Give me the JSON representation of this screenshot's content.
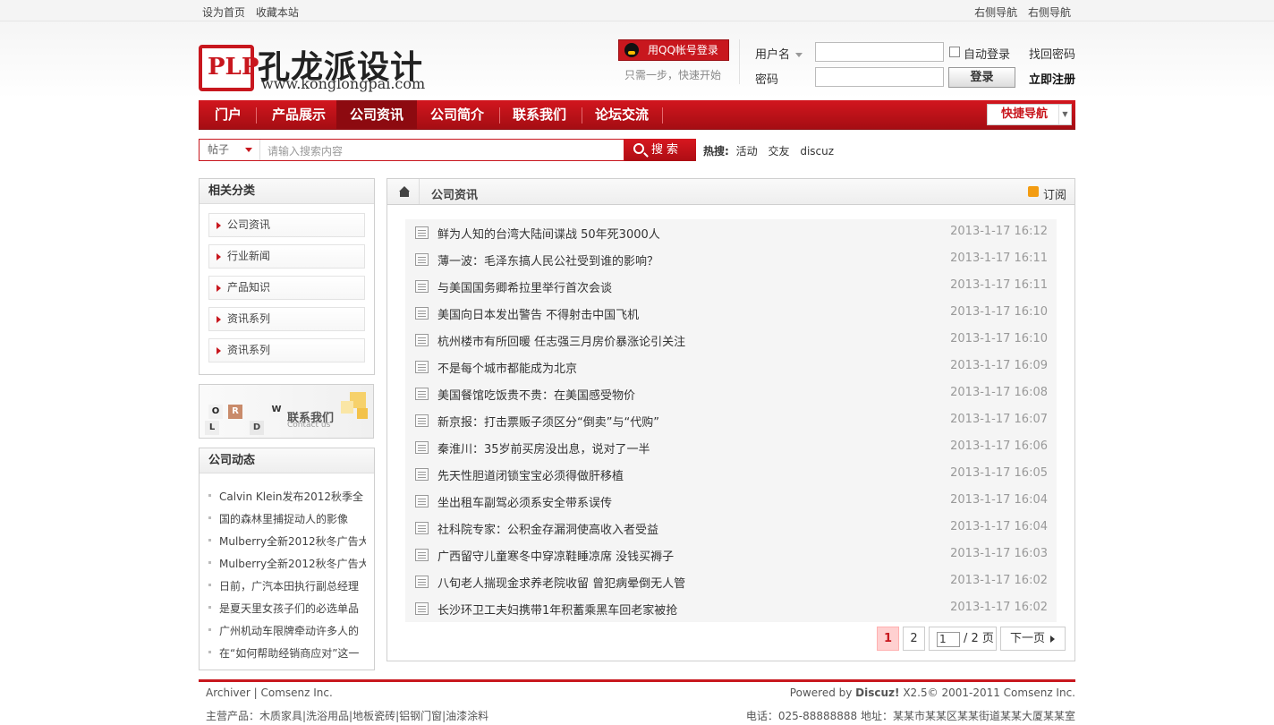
{
  "topbar": {
    "left": [
      "设为首页",
      "收藏本站"
    ],
    "right": [
      "右侧导航",
      "右侧导航"
    ]
  },
  "logo": {
    "mark": "PLP",
    "title": "孔龙派设计",
    "url": "www.konglongpai.com"
  },
  "qq": {
    "button": "用QQ帐号登录",
    "tip": "只需一步，快速开始"
  },
  "login": {
    "username_label": "用户名",
    "password_label": "密码",
    "auto_login": "自动登录",
    "find_password": "找回密码",
    "login_button": "登录",
    "register": "立即注册"
  },
  "nav": {
    "items": [
      "门户",
      "产品展示",
      "公司资讯",
      "公司简介",
      "联系我们",
      "论坛交流"
    ],
    "active": "公司资讯",
    "quick": "快捷导航"
  },
  "search": {
    "type": "帖子",
    "placeholder": "请输入搜索内容",
    "button": "搜索",
    "hot_label": "热搜:",
    "hot": [
      "活动",
      "交友",
      "discuz"
    ]
  },
  "sidebar": {
    "category_title": "相关分类",
    "categories": [
      "公司资讯",
      "行业新闻",
      "产品知识",
      "资讯系列",
      "资讯系列"
    ],
    "contact_banner": {
      "big": "联系我们",
      "small": "Contact us",
      "letters": [
        "W",
        "O",
        "R",
        "L",
        "D"
      ]
    },
    "news_title": "公司动态",
    "news": [
      "Calvin Klein发布2012秋季全",
      "国的森林里捕捉动人的影像",
      "Mulberry全新2012秋冬广告大",
      "Mulberry全新2012秋冬广告大",
      "日前，广汽本田执行副总经理",
      "是夏天里女孩子们的必选单品",
      "广州机动车限牌牵动许多人的",
      "在“如何帮助经销商应对”这一"
    ]
  },
  "main": {
    "breadcrumb": "公司资讯",
    "subscribe": "订阅",
    "articles": [
      {
        "title": "鲜为人知的台湾大陆间谍战 50年死3000人",
        "date": "2013-1-17 16:12"
      },
      {
        "title": "薄一波：毛泽东搞人民公社受到谁的影响？",
        "date": "2013-1-17 16:11"
      },
      {
        "title": "与美国国务卿希拉里举行首次会谈",
        "date": "2013-1-17 16:11"
      },
      {
        "title": "美国向日本发出警告 不得射击中国飞机",
        "date": "2013-1-17 16:10"
      },
      {
        "title": "杭州楼市有所回暖 任志强三月房价暴涨论引关注",
        "date": "2013-1-17 16:10"
      },
      {
        "title": "不是每个城市都能成为北京",
        "date": "2013-1-17 16:09"
      },
      {
        "title": "美国餐馆吃饭贵不贵：在美国感受物价",
        "date": "2013-1-17 16:08"
      },
      {
        "title": "新京报：打击票贩子须区分“倒卖”与“代购”",
        "date": "2013-1-17 16:07"
      },
      {
        "title": "秦淮川：35岁前买房没出息，说对了一半",
        "date": "2013-1-17 16:06"
      },
      {
        "title": "先天性胆道闭锁宝宝必须得做肝移植",
        "date": "2013-1-17 16:05"
      },
      {
        "title": "坐出租车副驾必须系安全带系误传",
        "date": "2013-1-17 16:04"
      },
      {
        "title": "社科院专家：公积金存漏洞使高收入者受益",
        "date": "2013-1-17 16:04"
      },
      {
        "title": "广西留守儿童寒冬中穿凉鞋睡凉席 没钱买褥子",
        "date": "2013-1-17 16:03"
      },
      {
        "title": "八旬老人揣现金求养老院收留 曾犯病晕倒无人管",
        "date": "2013-1-17 16:02"
      },
      {
        "title": "长沙环卫工夫妇携带1年积蓄乘黑车回老家被抢",
        "date": "2013-1-17 16:02"
      }
    ],
    "pagination": {
      "pages": [
        "1",
        "2"
      ],
      "current": "1",
      "input_value": "1",
      "total": "/ 2 页",
      "next": "下一页"
    }
  },
  "footer": {
    "left_links": "Archiver   | Comsenz Inc.",
    "powered_prefix": "Powered by ",
    "powered_brand": "Discuz!",
    "powered_suffix": " X2.5© 2001-2011 Comsenz Inc.",
    "products": "主营产品：木质家具|洗浴用品|地板瓷砖|铝钢门窗|油漆涂料",
    "contact": "电话：025-88888888 地址：某某市某某区某某街道某某大厦某某室"
  },
  "colors": {
    "brand_red": "#c8171e",
    "nav_active": "#8d0a10",
    "current_page": "#ffd0d0"
  },
  "icons": [
    "qq-icon",
    "search-icon",
    "home-icon",
    "rss-icon",
    "document-icon",
    "triangle-right-icon",
    "chevron-right-icon",
    "dropdown-caret-icon"
  ]
}
